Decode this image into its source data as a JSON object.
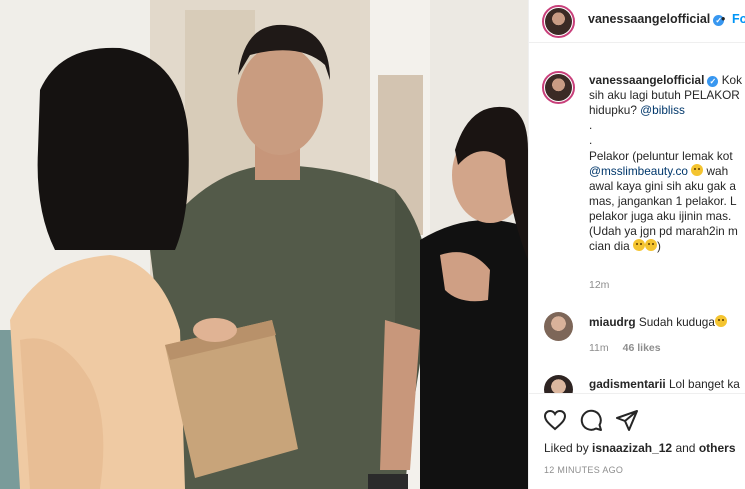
{
  "post": {
    "author": "vanessaangelofficial",
    "follow_label": "Fo",
    "separator": "•"
  },
  "caption": {
    "username": "vanessaangelofficial",
    "lines": [
      "Kok",
      "sih aku lagi butuh PELAKOR",
      "hidupku? @bibliss",
      ".",
      ".",
      "Pelakor (peluntur lemak kot",
      "@msslimbeauty.co 😳 wah",
      "awal kaya gini sih aku gak a",
      "mas, jangankan 1 pelakor. L",
      "pelakor juga aku ijinin mas.",
      "(Udah ya jgn pd marah2in m",
      "cian dia 😂😂)"
    ],
    "mention_1": "@bibliss",
    "mention_2": "@msslimbeauty.co",
    "time": "12m"
  },
  "comments": [
    {
      "username": "miaudrg",
      "text": "Sudah kuduga",
      "time": "11m",
      "likes": "46 likes"
    },
    {
      "username": "gadismentarii",
      "text": "Lol banget ka"
    }
  ],
  "actions": {
    "icons": [
      "heart-icon",
      "comment-icon",
      "share-icon"
    ],
    "liked_by_prefix": "Liked by",
    "liked_by_user": "isnaazizah_12",
    "liked_by_and": "and",
    "liked_by_others": "others",
    "time_ago": "12 MINUTES AGO"
  },
  "colors": {
    "link": "#00376b",
    "follow": "#0095f6",
    "verified": "#3897f0",
    "muted": "#8e8e8e",
    "text": "#262626"
  }
}
